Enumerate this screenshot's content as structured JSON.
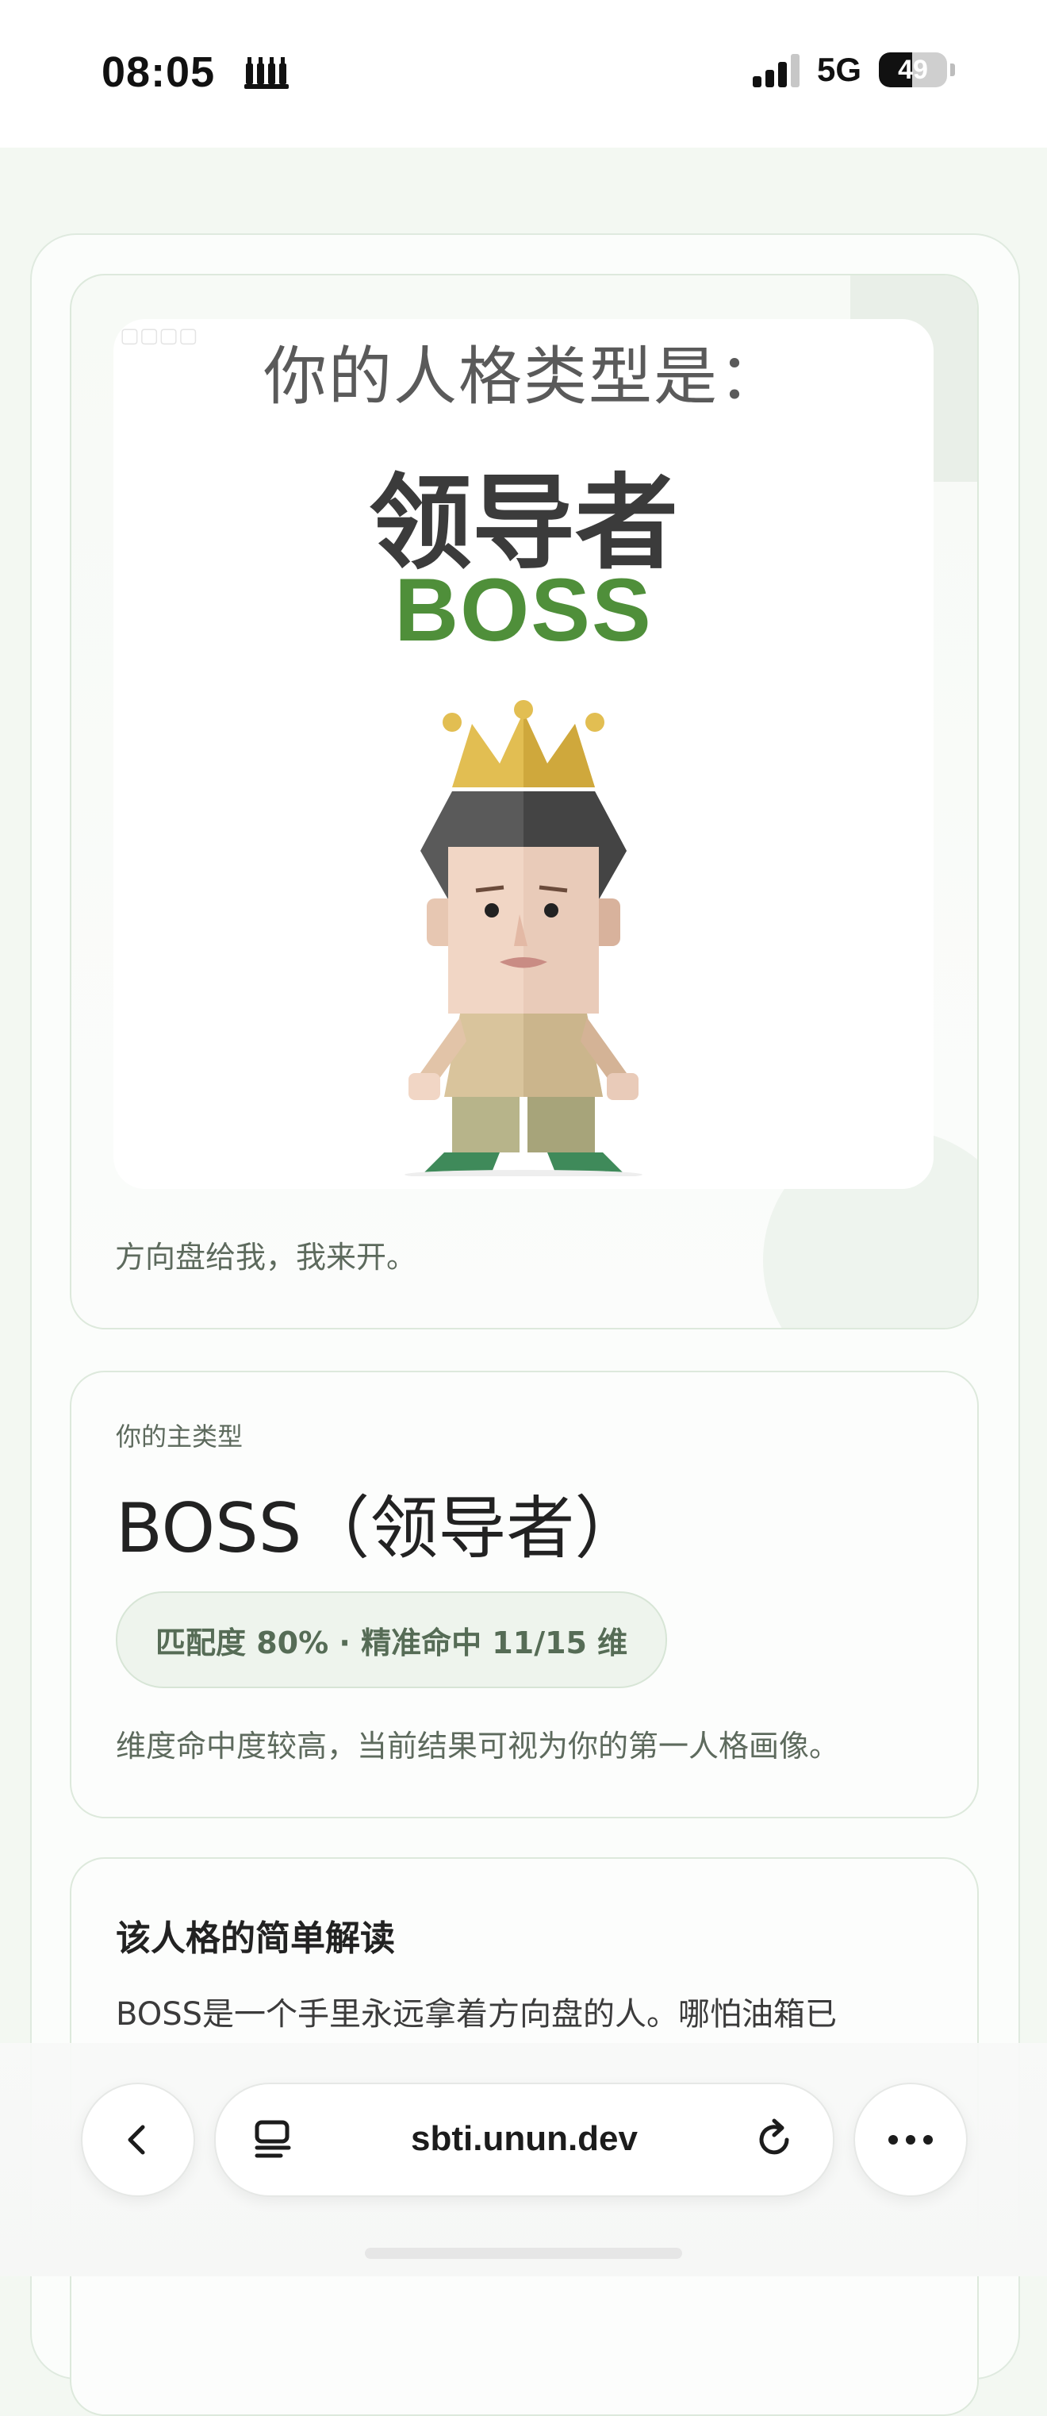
{
  "status_bar": {
    "time": "08:05",
    "extra_icon": "stacked-bottles-icon",
    "network": "5G",
    "battery_percent": "49",
    "battery_level": 0.49,
    "signal_bars_active": 3,
    "signal_bars_total": 4
  },
  "hero": {
    "poster_heading": "你的人格类型是：",
    "poster_type_cn": "领导者",
    "poster_type_en": "BOSS",
    "illustration": "crowned-boss-character",
    "caption": "方向盘给我，我来开。"
  },
  "result": {
    "eyebrow": "你的主类型",
    "title": "BOSS（领导者）",
    "match_badge": "匹配度 80% · 精准命中 11/15 维",
    "note": "维度命中度较高，当前结果可视为你的第一人格画像。"
  },
  "interpretation": {
    "title": "该人格的简单解读",
    "body": "BOSS是一个手里永远拿着方向盘的人。哪怕油箱已"
  },
  "browser": {
    "url": "sbti.unun.dev",
    "back_icon": "chevron-left-icon",
    "tabs_icon": "tabs-icon",
    "reload_icon": "reload-icon",
    "more_icon": "more-icon"
  },
  "colors": {
    "accent_green": "#4f8f3a",
    "background": "#f3f8f2",
    "card_border": "#dde9dc"
  }
}
